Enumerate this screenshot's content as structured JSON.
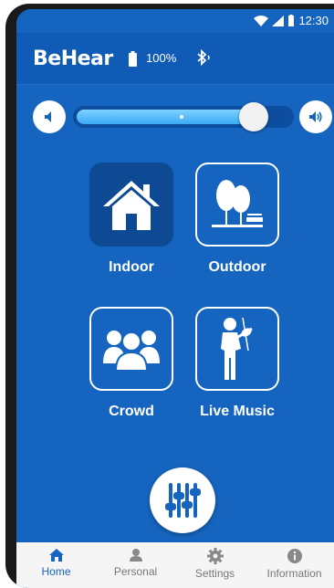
{
  "status_bar": {
    "time": "12:30"
  },
  "header": {
    "brand": "BeHear",
    "battery": "100%"
  },
  "volume": {
    "level": 0.83
  },
  "modes": [
    {
      "label": "Indoor",
      "icon": "house-icon",
      "active": true
    },
    {
      "label": "Outdoor",
      "icon": "trees-bench-icon",
      "active": false
    },
    {
      "label": "Crowd",
      "icon": "crowd-icon",
      "active": false
    },
    {
      "label": "Live Music",
      "icon": "violinist-icon",
      "active": false
    }
  ],
  "fab": {
    "icon": "equalizer-sliders-icon"
  },
  "nav": [
    {
      "label": "Home",
      "icon": "home-icon",
      "active": true
    },
    {
      "label": "Personal",
      "icon": "person-icon",
      "active": false
    },
    {
      "label": "Settings",
      "icon": "gear-icon",
      "active": false
    },
    {
      "label": "Information",
      "icon": "info-icon",
      "active": false
    }
  ],
  "colors": {
    "primary": "#1565c0",
    "active_tile": "#0d4a93",
    "slider_fill": "#3aa9f5"
  }
}
